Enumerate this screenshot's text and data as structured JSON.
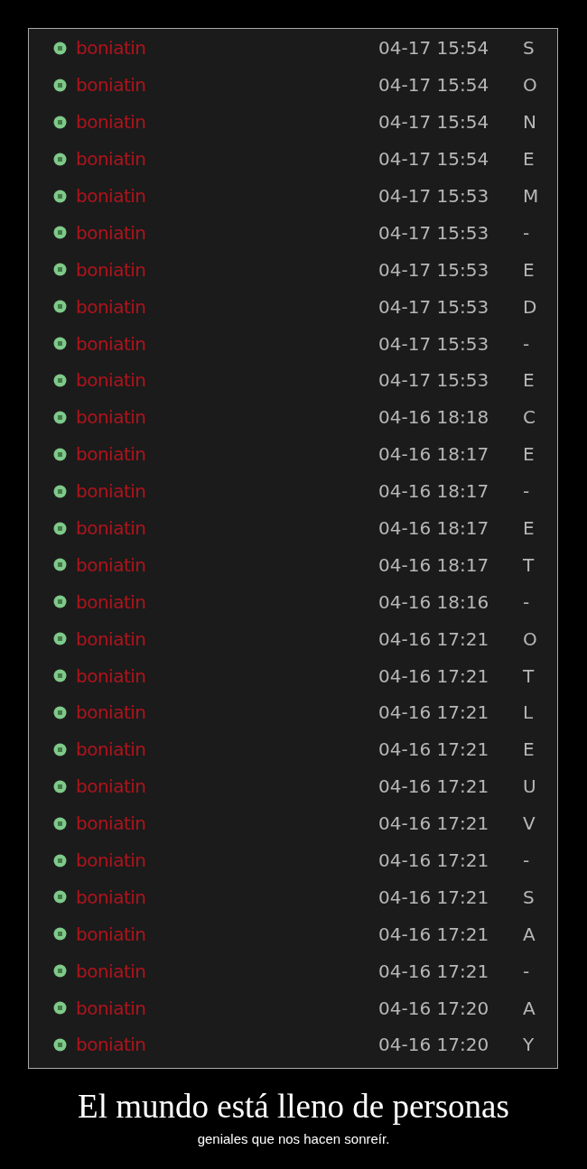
{
  "messages": [
    {
      "user": "boniatin",
      "time": "04-17 15:54",
      "text": "S"
    },
    {
      "user": "boniatin",
      "time": "04-17 15:54",
      "text": "O"
    },
    {
      "user": "boniatin",
      "time": "04-17 15:54",
      "text": "N"
    },
    {
      "user": "boniatin",
      "time": "04-17 15:54",
      "text": "E"
    },
    {
      "user": "boniatin",
      "time": "04-17 15:53",
      "text": "M"
    },
    {
      "user": "boniatin",
      "time": "04-17 15:53",
      "text": "-"
    },
    {
      "user": "boniatin",
      "time": "04-17 15:53",
      "text": "E"
    },
    {
      "user": "boniatin",
      "time": "04-17 15:53",
      "text": "D"
    },
    {
      "user": "boniatin",
      "time": "04-17 15:53",
      "text": "-"
    },
    {
      "user": "boniatin",
      "time": "04-17 15:53",
      "text": "E"
    },
    {
      "user": "boniatin",
      "time": "04-16 18:18",
      "text": "C"
    },
    {
      "user": "boniatin",
      "time": "04-16 18:17",
      "text": "E"
    },
    {
      "user": "boniatin",
      "time": "04-16 18:17",
      "text": "-"
    },
    {
      "user": "boniatin",
      "time": "04-16 18:17",
      "text": "E"
    },
    {
      "user": "boniatin",
      "time": "04-16 18:17",
      "text": "T"
    },
    {
      "user": "boniatin",
      "time": "04-16 18:16",
      "text": "-"
    },
    {
      "user": "boniatin",
      "time": "04-16 17:21",
      "text": "O"
    },
    {
      "user": "boniatin",
      "time": "04-16 17:21",
      "text": "T"
    },
    {
      "user": "boniatin",
      "time": "04-16 17:21",
      "text": "L"
    },
    {
      "user": "boniatin",
      "time": "04-16 17:21",
      "text": "E"
    },
    {
      "user": "boniatin",
      "time": "04-16 17:21",
      "text": "U"
    },
    {
      "user": "boniatin",
      "time": "04-16 17:21",
      "text": "V"
    },
    {
      "user": "boniatin",
      "time": "04-16 17:21",
      "text": "-"
    },
    {
      "user": "boniatin",
      "time": "04-16 17:21",
      "text": "S"
    },
    {
      "user": "boniatin",
      "time": "04-16 17:21",
      "text": "A"
    },
    {
      "user": "boniatin",
      "time": "04-16 17:21",
      "text": "-"
    },
    {
      "user": "boniatin",
      "time": "04-16 17:20",
      "text": "A"
    },
    {
      "user": "boniatin",
      "time": "04-16 17:20",
      "text": "Y"
    }
  ],
  "caption": {
    "title": "El mundo está lleno de personas",
    "subtitle": "geniales que nos hacen sonreír."
  }
}
